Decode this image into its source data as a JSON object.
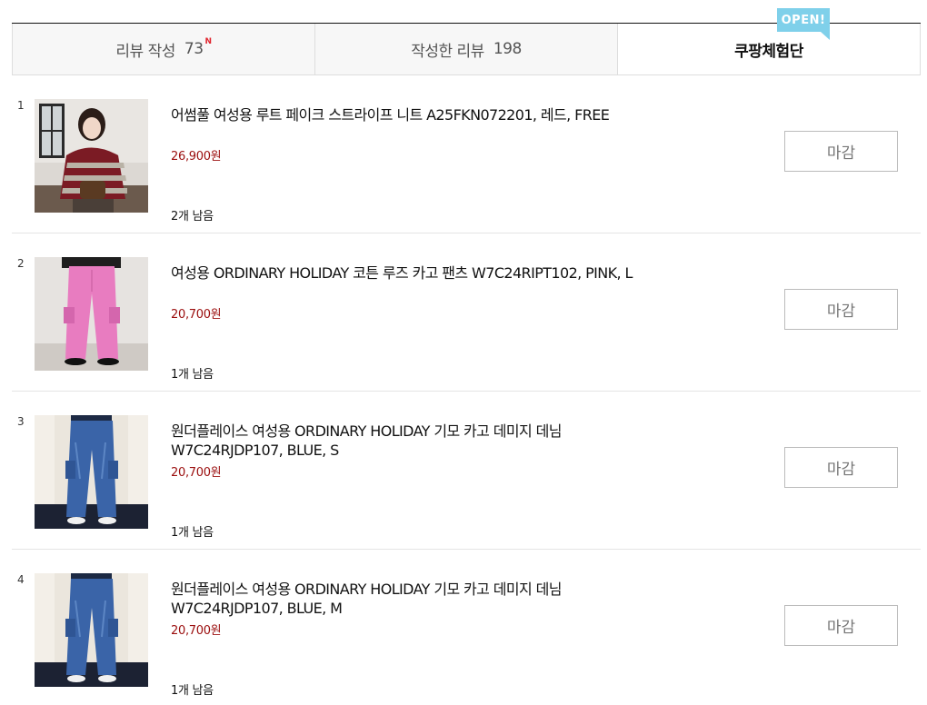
{
  "tabs": [
    {
      "label": "리뷰 작성",
      "count": "73",
      "badge": "N"
    },
    {
      "label": "작성한 리뷰",
      "count": "198"
    },
    {
      "label": "쿠팡체험단"
    }
  ],
  "open_badge": "OPEN!",
  "colors": {
    "price": "#9b0e0e",
    "open_badge": "#7fd0ea",
    "new_badge": "#e0252e"
  },
  "items": [
    {
      "rank": "1",
      "title": "어썸풀 여성용 루트 페이크 스트라이프 니트 A25FKN072201, 레드, FREE",
      "price": "26,900원",
      "remain": "2개 남음",
      "button": "마감",
      "image": "woman-striped-knit-photo"
    },
    {
      "rank": "2",
      "title": "여성용 ORDINARY HOLIDAY 코튼 루즈 카고 팬츠 W7C24RIPT102, PINK, L",
      "price": "20,700원",
      "remain": "1개 남음",
      "button": "마감",
      "image": "pink-cargo-pants-photo"
    },
    {
      "rank": "3",
      "title": "원더플레이스 여성용 ORDINARY HOLIDAY 기모 카고 데미지 데님 W7C24RJDP107, BLUE, S",
      "price": "20,700원",
      "remain": "1개 남음",
      "button": "마감",
      "image": "blue-denim-cargo-photo"
    },
    {
      "rank": "4",
      "title": "원더플레이스 여성용 ORDINARY HOLIDAY 기모 카고 데미지 데님 W7C24RJDP107, BLUE, M",
      "price": "20,700원",
      "remain": "1개 남음",
      "button": "마감",
      "image": "blue-denim-cargo-photo"
    }
  ]
}
